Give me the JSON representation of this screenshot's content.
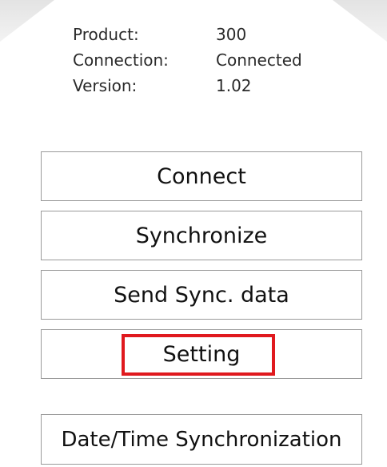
{
  "info": {
    "product_label": "Product:",
    "product_value": "300",
    "connection_label": "Connection:",
    "connection_value": "Connected",
    "version_label": "Version:",
    "version_value": "1.02"
  },
  "buttons": {
    "connect": "Connect",
    "synchronize": "Synchronize",
    "send_sync_data": "Send Sync. data",
    "setting": "Setting",
    "date_time_sync": "Date/Time Synchronization"
  },
  "colors": {
    "highlight": "#e0191e",
    "button_border": "#9a9a9a",
    "panel_gradient": "#e3e3e3"
  }
}
